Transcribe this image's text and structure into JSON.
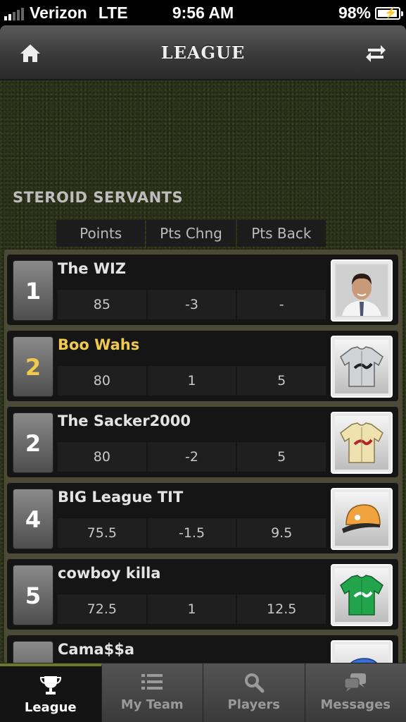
{
  "status_bar": {
    "carrier": "Verizon",
    "network": "LTE",
    "time": "9:56 AM",
    "battery": "98%"
  },
  "nav": {
    "title": "LEAGUE",
    "home_icon": "home-icon",
    "swap_icon": "swap-arrows-icon"
  },
  "league": {
    "name": "STEROID SERVANTS"
  },
  "columns": [
    "Points",
    "Pts Chng",
    "Pts Back"
  ],
  "standings": [
    {
      "rank": "1",
      "team": "The WIZ",
      "points": "85",
      "change": "-3",
      "back": "-",
      "image": "man-photo",
      "highlight": false
    },
    {
      "rank": "2",
      "team": "Boo Wahs",
      "points": "80",
      "change": "1",
      "back": "5",
      "image": "gray-jersey",
      "highlight": true
    },
    {
      "rank": "2",
      "team": "The Sacker2000",
      "points": "80",
      "change": "-2",
      "back": "5",
      "image": "cream-jersey",
      "highlight": false
    },
    {
      "rank": "4",
      "team": "BIG League TIT",
      "points": "75.5",
      "change": "-1.5",
      "back": "9.5",
      "image": "orange-cap",
      "highlight": false
    },
    {
      "rank": "5",
      "team": "cowboy killa",
      "points": "72.5",
      "change": "1",
      "back": "12.5",
      "image": "green-jersey",
      "highlight": false
    },
    {
      "rank": "",
      "team": "Cama$$a",
      "points": "",
      "change": "",
      "back": "",
      "image": "blue-helmet",
      "highlight": false
    }
  ],
  "tabs": [
    {
      "label": "League",
      "icon": "trophy-icon",
      "active": true
    },
    {
      "label": "My Team",
      "icon": "list-icon",
      "active": false
    },
    {
      "label": "Players",
      "icon": "search-icon",
      "active": false
    },
    {
      "label": "Messages",
      "icon": "chat-bubbles-icon",
      "active": false
    }
  ],
  "colors": {
    "highlight": "#f1c94d",
    "active_tab_accent": "#6b7a2a"
  }
}
